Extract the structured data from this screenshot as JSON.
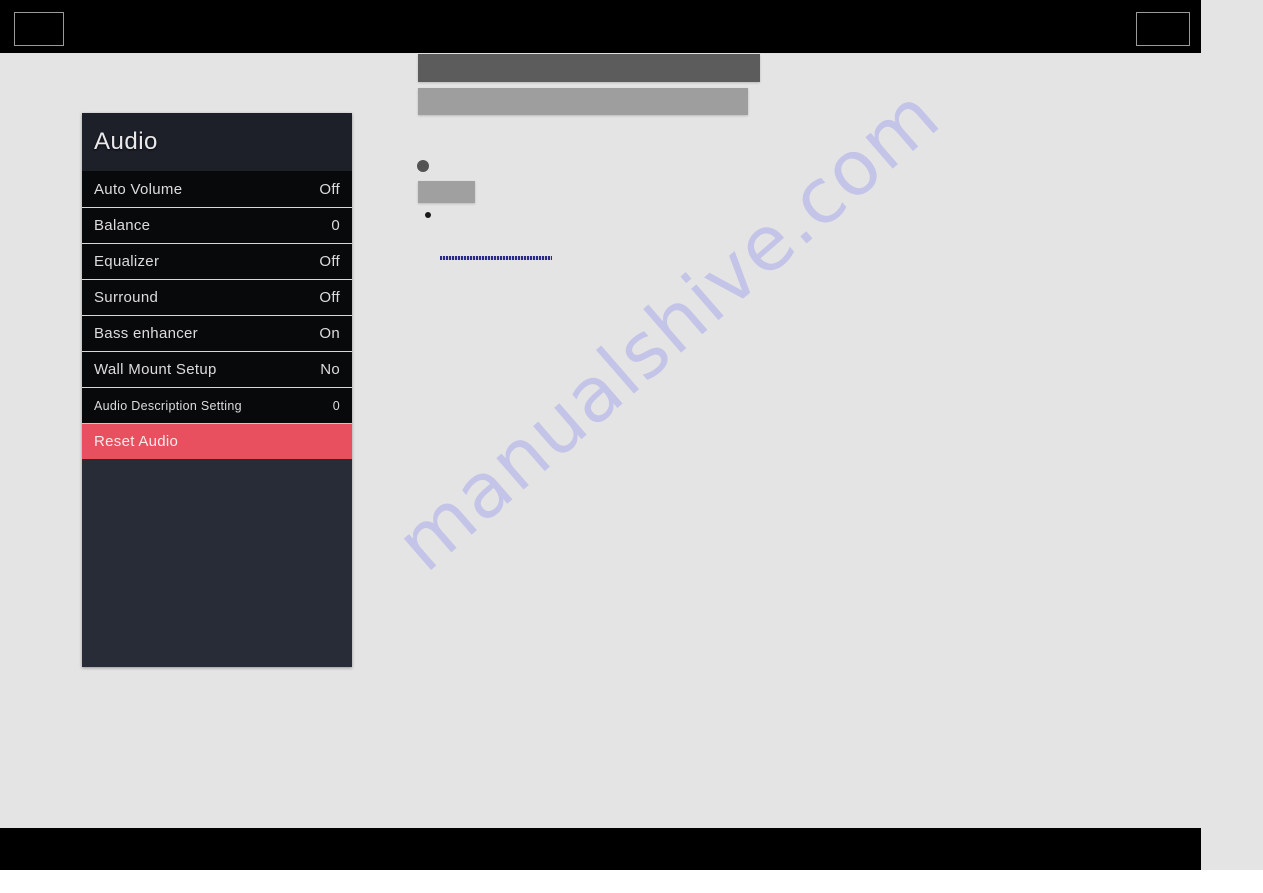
{
  "page": {
    "background_color": "#e4e4e4",
    "band_color": "#000000",
    "watermark": "manualshive.com"
  },
  "osd": {
    "title": "Audio",
    "accent_color": "#e8505f",
    "panel_color": "#272c36",
    "row_color": "#08090b",
    "rows": [
      {
        "label": "Auto Volume",
        "value": "Off",
        "style": "normal"
      },
      {
        "label": "Balance",
        "value": "0",
        "style": "normal"
      },
      {
        "label": "Equalizer",
        "value": "Off",
        "style": "normal"
      },
      {
        "label": "Surround",
        "value": "Off",
        "style": "normal"
      },
      {
        "label": "Bass enhancer",
        "value": "On",
        "style": "normal"
      },
      {
        "label": "Wall Mount Setup",
        "value": "No",
        "style": "normal"
      },
      {
        "label": "Audio Description Setting",
        "value": "0",
        "style": "small"
      },
      {
        "label": "Reset Audio",
        "value": "",
        "style": "danger"
      }
    ]
  },
  "content": {
    "redacted_bar_1_color": "#5c5c5c",
    "redacted_bar_2_color": "#9e9e9e",
    "redacted_box_color": "#a0a0a0",
    "bullet_large_color": "#545454",
    "bullet_small_color": "#1a1a1a",
    "dotted_link_color": "#2a2a8c"
  }
}
